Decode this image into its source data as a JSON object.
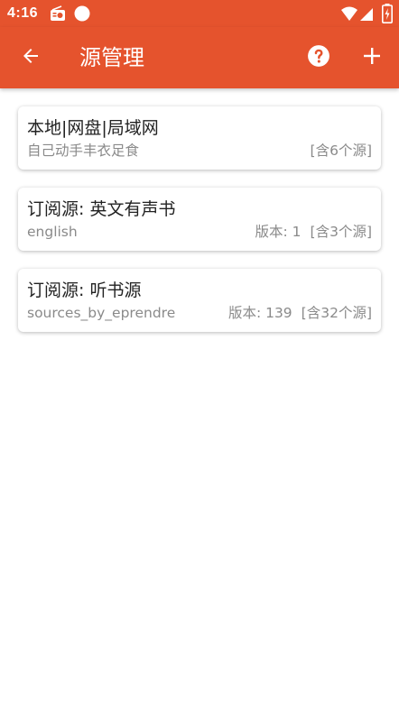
{
  "status_bar": {
    "time": "4:16",
    "icons": [
      "radio-icon",
      "circle-icon",
      "wifi-icon",
      "signal-icon",
      "battery-charging-icon"
    ]
  },
  "app_bar": {
    "title": "源管理",
    "back_icon": "arrow-back-icon",
    "help_icon": "help-circle-icon",
    "add_icon": "plus-icon"
  },
  "colors": {
    "primary": "#e5532d",
    "on_primary": "#ffffff",
    "title_text": "#222222",
    "secondary_text": "#8a8a8a"
  },
  "sources": [
    {
      "title": "本地|网盘|局域网",
      "subtitle": "自己动手丰衣足食",
      "version": "",
      "count": "[含6个源]"
    },
    {
      "title": "订阅源: 英文有声书",
      "subtitle": "english",
      "version": "版本: 1",
      "count": "[含3个源]"
    },
    {
      "title": "订阅源: 听书源",
      "subtitle": "sources_by_eprendre",
      "version": "版本: 139",
      "count": "[含32个源]"
    }
  ]
}
